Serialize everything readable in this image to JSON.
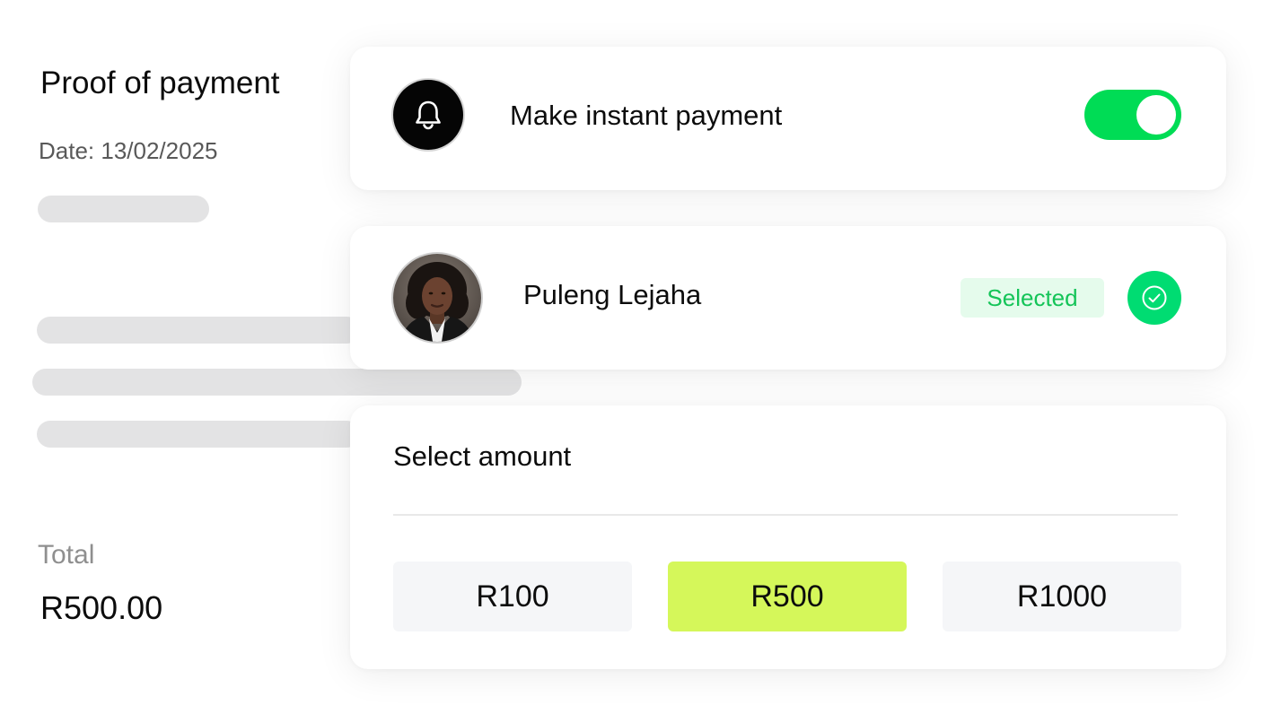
{
  "receipt": {
    "title": "Proof of payment",
    "date": "Date: 13/02/2025",
    "total_label": "Total",
    "total_value": "R500.00"
  },
  "instant_payment": {
    "icon": "bell-icon",
    "label": "Make instant payment",
    "toggle_on": true,
    "toggle_color": "#00dc55"
  },
  "recipient": {
    "name": "Puleng Lejaha",
    "status": "Selected",
    "status_color": "#14c458",
    "check_icon": "check-circle-icon",
    "check_color": "#00dc72"
  },
  "amount": {
    "title": "Select amount",
    "options": [
      {
        "label": "R100",
        "selected": false
      },
      {
        "label": "R500",
        "selected": true
      },
      {
        "label": "R1000",
        "selected": false
      }
    ],
    "selected_color": "#d5f75a"
  }
}
